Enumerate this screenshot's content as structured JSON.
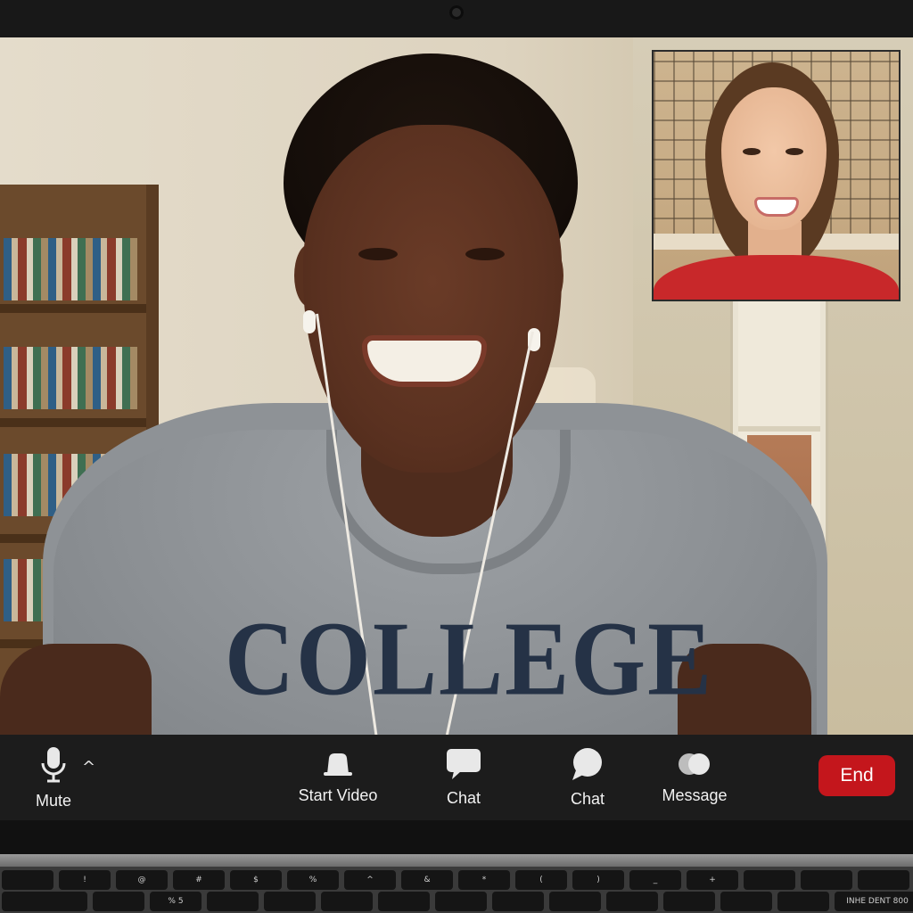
{
  "controls": {
    "mute": {
      "label": "Mute",
      "icon": "microphone-icon"
    },
    "mute_caret": "^",
    "start_video": {
      "label": "Start Video",
      "icon": "video-camera-icon"
    },
    "chat_1": {
      "label": "Chat",
      "icon": "chat-bubble-icon"
    },
    "chat_2": {
      "label": "Chat",
      "icon": "speech-bubble-icon"
    },
    "message": {
      "label": "Message",
      "icon": "message-bubbles-icon"
    },
    "end": {
      "label": "End"
    }
  },
  "main_video": {
    "shirt_text": "COLLEGE"
  },
  "keyboard": {
    "row1": [
      "",
      "!",
      "@",
      "#",
      "$",
      "%",
      "^",
      "&",
      "*",
      "(",
      ")",
      "_",
      "+",
      "",
      "",
      ""
    ],
    "row2": [
      "",
      "",
      "%\n5",
      "",
      "",
      "",
      "",
      "",
      "",
      "",
      "",
      "",
      "",
      "",
      "",
      "INHE DENT 800"
    ]
  },
  "colors": {
    "control_bar": "#1c1c1c",
    "end_button": "#c4161c",
    "label_text": "#f2f2f2"
  }
}
